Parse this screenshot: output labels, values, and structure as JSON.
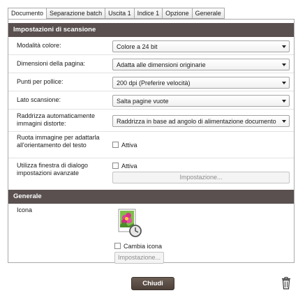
{
  "tabs": [
    {
      "label": "Documento",
      "active": true
    },
    {
      "label": "Separazione batch",
      "active": false
    },
    {
      "label": "Uscita 1",
      "active": false
    },
    {
      "label": "Indice 1",
      "active": false
    },
    {
      "label": "Opzione",
      "active": false
    },
    {
      "label": "Generale",
      "active": false
    }
  ],
  "scan_settings": {
    "header": "Impostazioni di scansione",
    "color_mode": {
      "label": "Modalità colore:",
      "value": "Colore a 24 bit"
    },
    "page_size": {
      "label": "Dimensioni della pagina:",
      "value": "Adatta alle dimensioni originarie"
    },
    "dpi": {
      "label": "Punti per pollice:",
      "value": "200 dpi (Preferire velocità)"
    },
    "scan_side": {
      "label": "Lato scansione:",
      "value": "Salta pagine vuote"
    },
    "deskew": {
      "label": "Raddrizza automaticamente immagini distorte:",
      "value": "Raddrizza in base ad angolo di alimentazione documento"
    },
    "rotate": {
      "label": "Ruota immagine per adattarla all'orientamento del testo",
      "checkbox_label": "Attiva",
      "checked": false
    },
    "advanced": {
      "label": "Utilizza finestra di dialogo impostazioni avanzate",
      "checkbox_label": "Attiva",
      "checked": false,
      "button": "Impostazione..."
    }
  },
  "general": {
    "header": "Generale",
    "icon_label": "Icona",
    "icon": "photo-app-icon",
    "change_icon": {
      "label": "Cambia icona",
      "checked": false
    },
    "settings_button": "Impostazione..."
  },
  "footer": {
    "close_button": "Chiudi",
    "delete_icon": "trash-icon"
  },
  "colors": {
    "header_bg": "#5a5050",
    "close_bg": "#5a4d44"
  }
}
